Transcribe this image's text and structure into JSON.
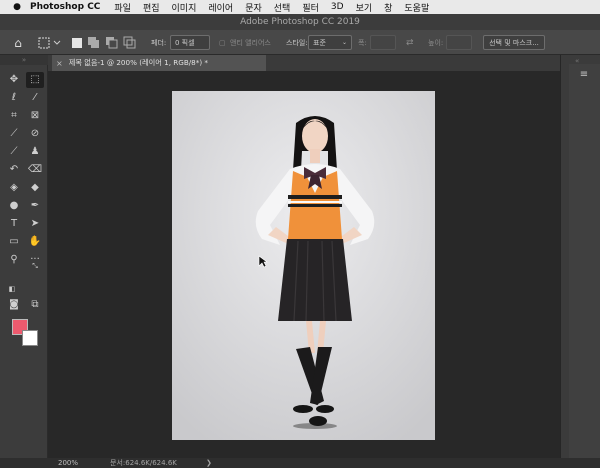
{
  "menubar": {
    "apple": "",
    "app": "Photoshop CC",
    "items": [
      "파일",
      "편집",
      "이미지",
      "레이어",
      "문자",
      "선택",
      "필터",
      "3D",
      "보기",
      "창",
      "도움말"
    ]
  },
  "window": {
    "title": "Adobe Photoshop CC 2019"
  },
  "options": {
    "feather_label": "페더:",
    "feather_value": "0 픽셀",
    "antialias_label": "앤티 앨리어스",
    "style_label": "스타일:",
    "style_value": "표준",
    "width_label": "폭:",
    "height_label": "높이:",
    "select_mask_label": "선택 및 마스크..."
  },
  "document": {
    "tab_title": "제목 없음-1 @ 200% (레이어 1, RGB/8*) *"
  },
  "status": {
    "zoom": "200%",
    "doc_size": "문서:624.6K/624.6K",
    "arrow": "❯"
  },
  "colors": {
    "foreground": "#ee5a6e",
    "background": "#ffffff",
    "skirt": "#262426",
    "vest": "#f0913a"
  },
  "tools": [
    "move-icon",
    "marquee-icon",
    "lasso-icon",
    "magic-wand-icon",
    "crop-icon",
    "frame-icon",
    "eyedropper-icon",
    "healing-icon",
    "brush-icon",
    "stamp-icon",
    "history-brush-icon",
    "eraser-icon",
    "paint-bucket-icon",
    "blur-icon",
    "dodge-icon",
    "pen-icon",
    "text-icon",
    "path-select-icon",
    "shape-icon",
    "hand-icon",
    "zoom-icon",
    "more-icon",
    "quick-mask-icon",
    "screen-mode-icon"
  ]
}
